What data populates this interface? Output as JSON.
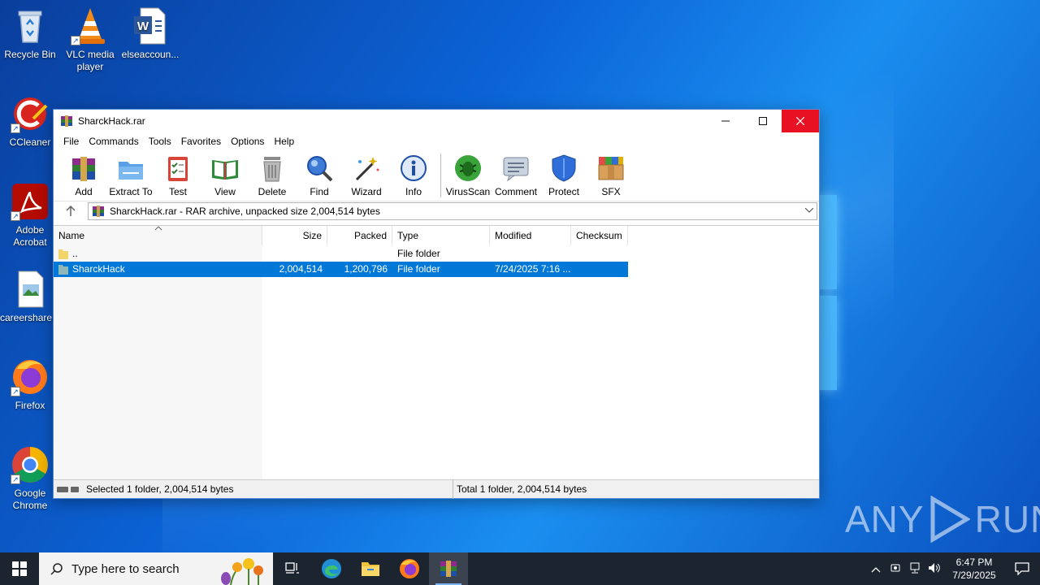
{
  "desktop": {
    "icons": [
      {
        "label": "Recycle Bin"
      },
      {
        "label": "VLC media player"
      },
      {
        "label": "elseaccoun..."
      },
      {
        "label": "CCleaner"
      },
      {
        "label": "Adobe Acrobat"
      },
      {
        "label": "careershare..."
      },
      {
        "label": "Firefox"
      },
      {
        "label": "Google Chrome"
      }
    ]
  },
  "window": {
    "title": "SharckHack.rar",
    "menu": [
      "File",
      "Commands",
      "Tools",
      "Favorites",
      "Options",
      "Help"
    ],
    "toolbar": [
      "Add",
      "Extract To",
      "Test",
      "View",
      "Delete",
      "Find",
      "Wizard",
      "Info",
      "VirusScan",
      "Comment",
      "Protect",
      "SFX"
    ],
    "address": "SharckHack.rar - RAR archive, unpacked size 2,004,514 bytes",
    "columns": {
      "name": "Name",
      "size": "Size",
      "packed": "Packed",
      "type": "Type",
      "modified": "Modified",
      "checksum": "Checksum"
    },
    "rows": [
      {
        "name": "..",
        "size": "",
        "packed": "",
        "type": "File folder",
        "modified": "",
        "checksum": ""
      },
      {
        "name": "SharckHack",
        "size": "2,004,514",
        "packed": "1,200,796",
        "type": "File folder",
        "modified": "7/24/2025 7:16 ...",
        "checksum": "",
        "selected": true
      }
    ],
    "status_left": "Selected 1 folder, 2,004,514 bytes",
    "status_right": "Total 1 folder, 2,004,514 bytes"
  },
  "watermark": {
    "left": "ANY",
    "right": "RUN"
  },
  "taskbar": {
    "search_placeholder": "Type here to search",
    "time": "6:47 PM",
    "date": "7/29/2025"
  },
  "colors": {
    "selection": "#0078d7",
    "close": "#e81123",
    "taskbar": "#1c2430"
  }
}
